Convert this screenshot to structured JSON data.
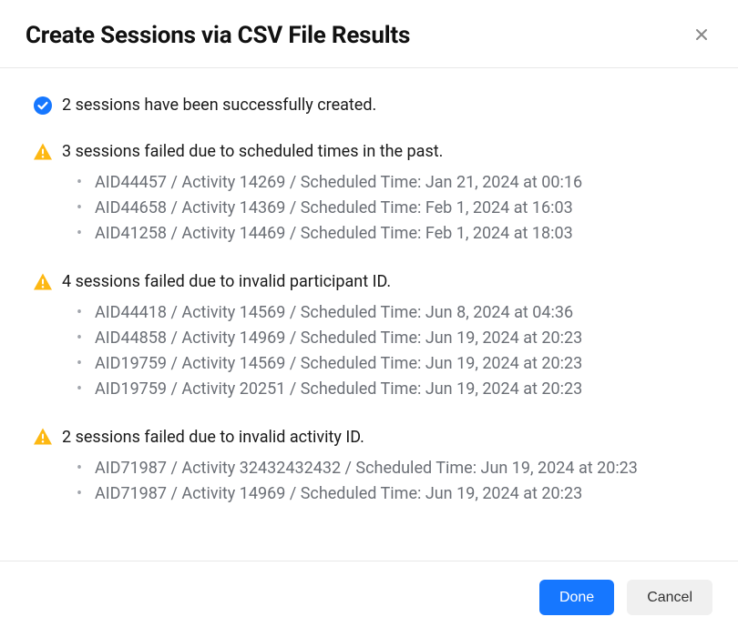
{
  "header": {
    "title": "Create Sessions via CSV File Results"
  },
  "success": {
    "message": "2 sessions have been successfully created."
  },
  "errors": [
    {
      "message": "3 sessions failed due to scheduled times in the past.",
      "items": [
        "AID44457 / Activity 14269 / Scheduled Time: Jan 21, 2024 at 00:16",
        "AID44658 / Activity 14369 / Scheduled Time: Feb 1, 2024 at 16:03",
        "AID41258 / Activity 14469 / Scheduled Time: Feb 1, 2024 at 18:03"
      ]
    },
    {
      "message": "4 sessions failed due to invalid participant ID.",
      "items": [
        "AID44418 / Activity 14569 / Scheduled Time: Jun 8, 2024 at 04:36",
        "AID44858 / Activity 14969 / Scheduled Time: Jun 19, 2024 at 20:23",
        "AID19759 / Activity 14569 / Scheduled Time: Jun 19, 2024 at 20:23",
        "AID19759 / Activity 20251 / Scheduled Time: Jun 19, 2024 at 20:23"
      ]
    },
    {
      "message": "2 sessions failed due to invalid activity ID.",
      "items": [
        "AID71987 / Activity 32432432432 / Scheduled Time: Jun 19, 2024 at 20:23",
        "AID71987 / Activity 14969 / Scheduled Time: Jun 19, 2024 at 20:23"
      ]
    }
  ],
  "footer": {
    "done_label": "Done",
    "cancel_label": "Cancel"
  }
}
